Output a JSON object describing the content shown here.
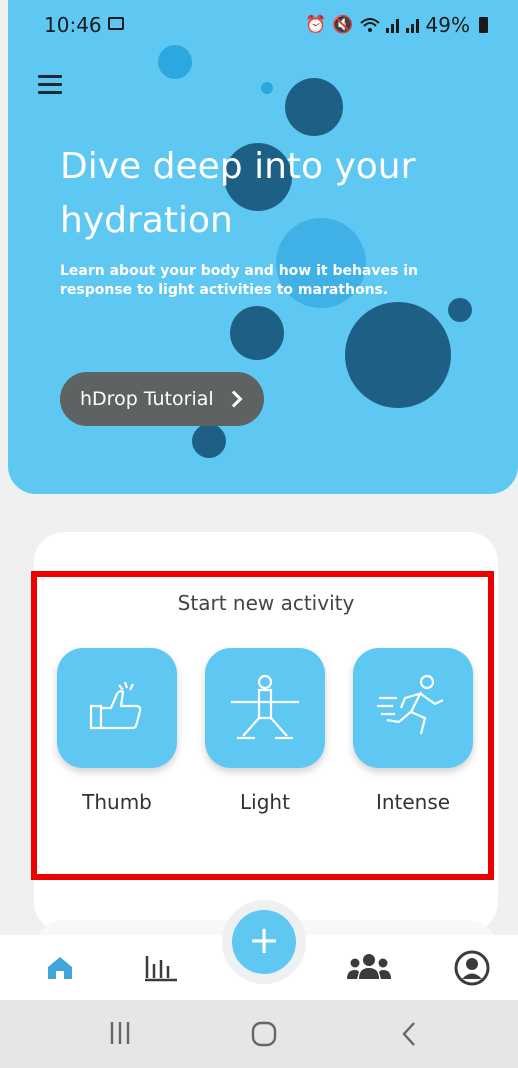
{
  "status_bar": {
    "time": "10:46",
    "battery": "49%",
    "icons": [
      "image-icon",
      "alarm-icon",
      "mute-icon",
      "wifi-icon",
      "signal-icon",
      "signal-icon",
      "battery-icon"
    ]
  },
  "hero": {
    "title": "Dive deep into your hydration",
    "subtitle": "Learn about your body and how it behaves in response to light activities to marathons.",
    "tutorial_button": "hDrop Tutorial"
  },
  "activity": {
    "title": "Start new activity",
    "items": [
      {
        "label": "Thumb",
        "icon": "thumbs-up-icon"
      },
      {
        "label": "Light",
        "icon": "yoga-pose-icon"
      },
      {
        "label": "Intense",
        "icon": "running-person-icon"
      }
    ]
  },
  "bottom_nav": {
    "items": [
      "home-icon",
      "bar-chart-icon",
      "add-icon",
      "group-icon",
      "profile-icon"
    ],
    "fab_label": "+"
  },
  "colors": {
    "accent": "#5ec8f2",
    "bubble_dark": "#1e5f86",
    "highlight": "#ee0000"
  }
}
